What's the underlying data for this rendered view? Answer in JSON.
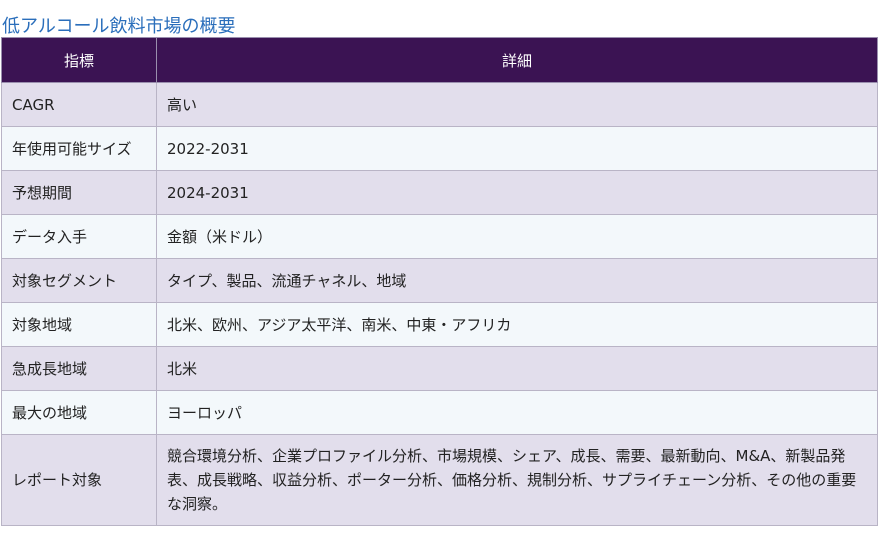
{
  "title": "低アルコール飲料市場の概要",
  "table": {
    "headers": [
      "指標",
      "詳細"
    ],
    "rows": [
      {
        "label": "CAGR",
        "value": "高い"
      },
      {
        "label": "年使用可能サイズ",
        "value": "2022-2031"
      },
      {
        "label": "予想期間",
        "value": "2024-2031"
      },
      {
        "label": "データ入手",
        "value": "金額（米ドル）"
      },
      {
        "label": "対象セグメント",
        "value": "タイプ、製品、流通チャネル、地域"
      },
      {
        "label": "対象地域",
        "value": "北米、欧州、アジア太平洋、南米、中東・アフリカ"
      },
      {
        "label": "急成長地域",
        "value": "北米"
      },
      {
        "label": "最大の地域",
        "value": "ヨーロッパ"
      },
      {
        "label": "レポート対象",
        "value": "競合環境分析、企業プロファイル分析、市場規模、シェア、成長、需要、最新動向、M&A、新製品発表、成長戦略、収益分析、ポーター分析、価格分析、規制分析、サプライチェーン分析、その他の重要な洞察。"
      }
    ]
  },
  "colors": {
    "title": "#2a6ebb",
    "header_bg": "#3b1353",
    "row_odd_bg": "#e2deec",
    "row_even_bg": "#f3f8fb"
  }
}
